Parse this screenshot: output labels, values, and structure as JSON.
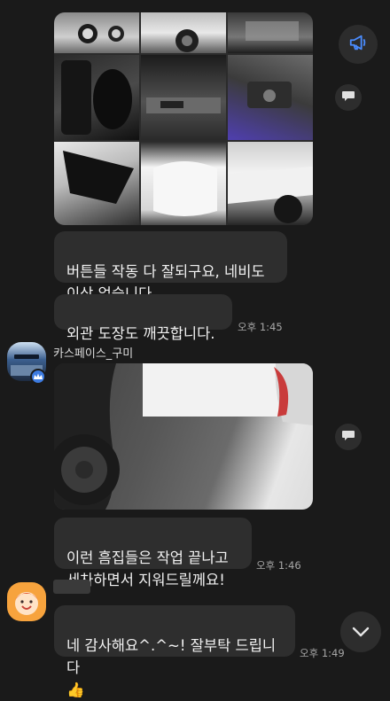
{
  "messages": {
    "m1": {
      "text": "버튼들 작동 다 잘되구요, 네비도\n이상 없습니다."
    },
    "m2": {
      "text": "외관 도장도 깨끗합니다.",
      "time": "오후 1:45"
    },
    "m3": {
      "sender": "카스페이스_구미",
      "text": "이런 흠집들은 작업 끝나고\n세차하면서 지워드릴께요!",
      "time": "오후 1:46"
    },
    "m4": {
      "text": "네 감사해요^.^~! 잘부탁 드립니다\n👍",
      "time": "오후 1:49"
    }
  },
  "icons": {
    "announce": "megaphone-icon",
    "share": "speech-bubble-share-icon",
    "scroll_down": "chevron-down-icon",
    "verified": "crown-icon"
  },
  "colors": {
    "background": "#1a1a1a",
    "bubble": "#2e2e2e",
    "accent_blue": "#3d7be0",
    "avatar_orange": "#f7a33d"
  }
}
